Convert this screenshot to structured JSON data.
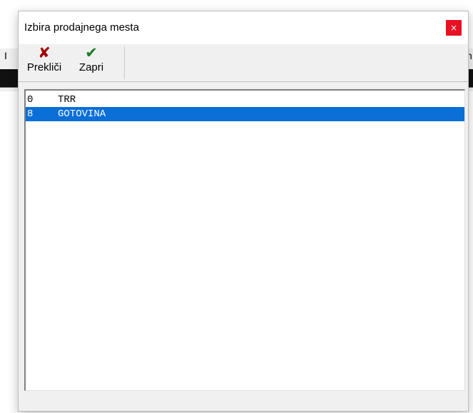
{
  "background": {
    "left_text": "I",
    "right_text": "n"
  },
  "window": {
    "title": "Izbira prodajnega mesta",
    "close_label": "×"
  },
  "toolbar": {
    "buttons": [
      {
        "label": "Prekliči",
        "icon": "cancel-x-icon",
        "color": "#a00000"
      },
      {
        "label": "Zapri",
        "icon": "checkmark-icon",
        "color": "#1a7a2a"
      }
    ]
  },
  "list": {
    "rows": [
      {
        "code": "0",
        "name": "TRR",
        "selected": false
      },
      {
        "code": "8",
        "name": "GOTOVINA",
        "selected": true
      }
    ],
    "selection_color": "#0a6fd7"
  }
}
